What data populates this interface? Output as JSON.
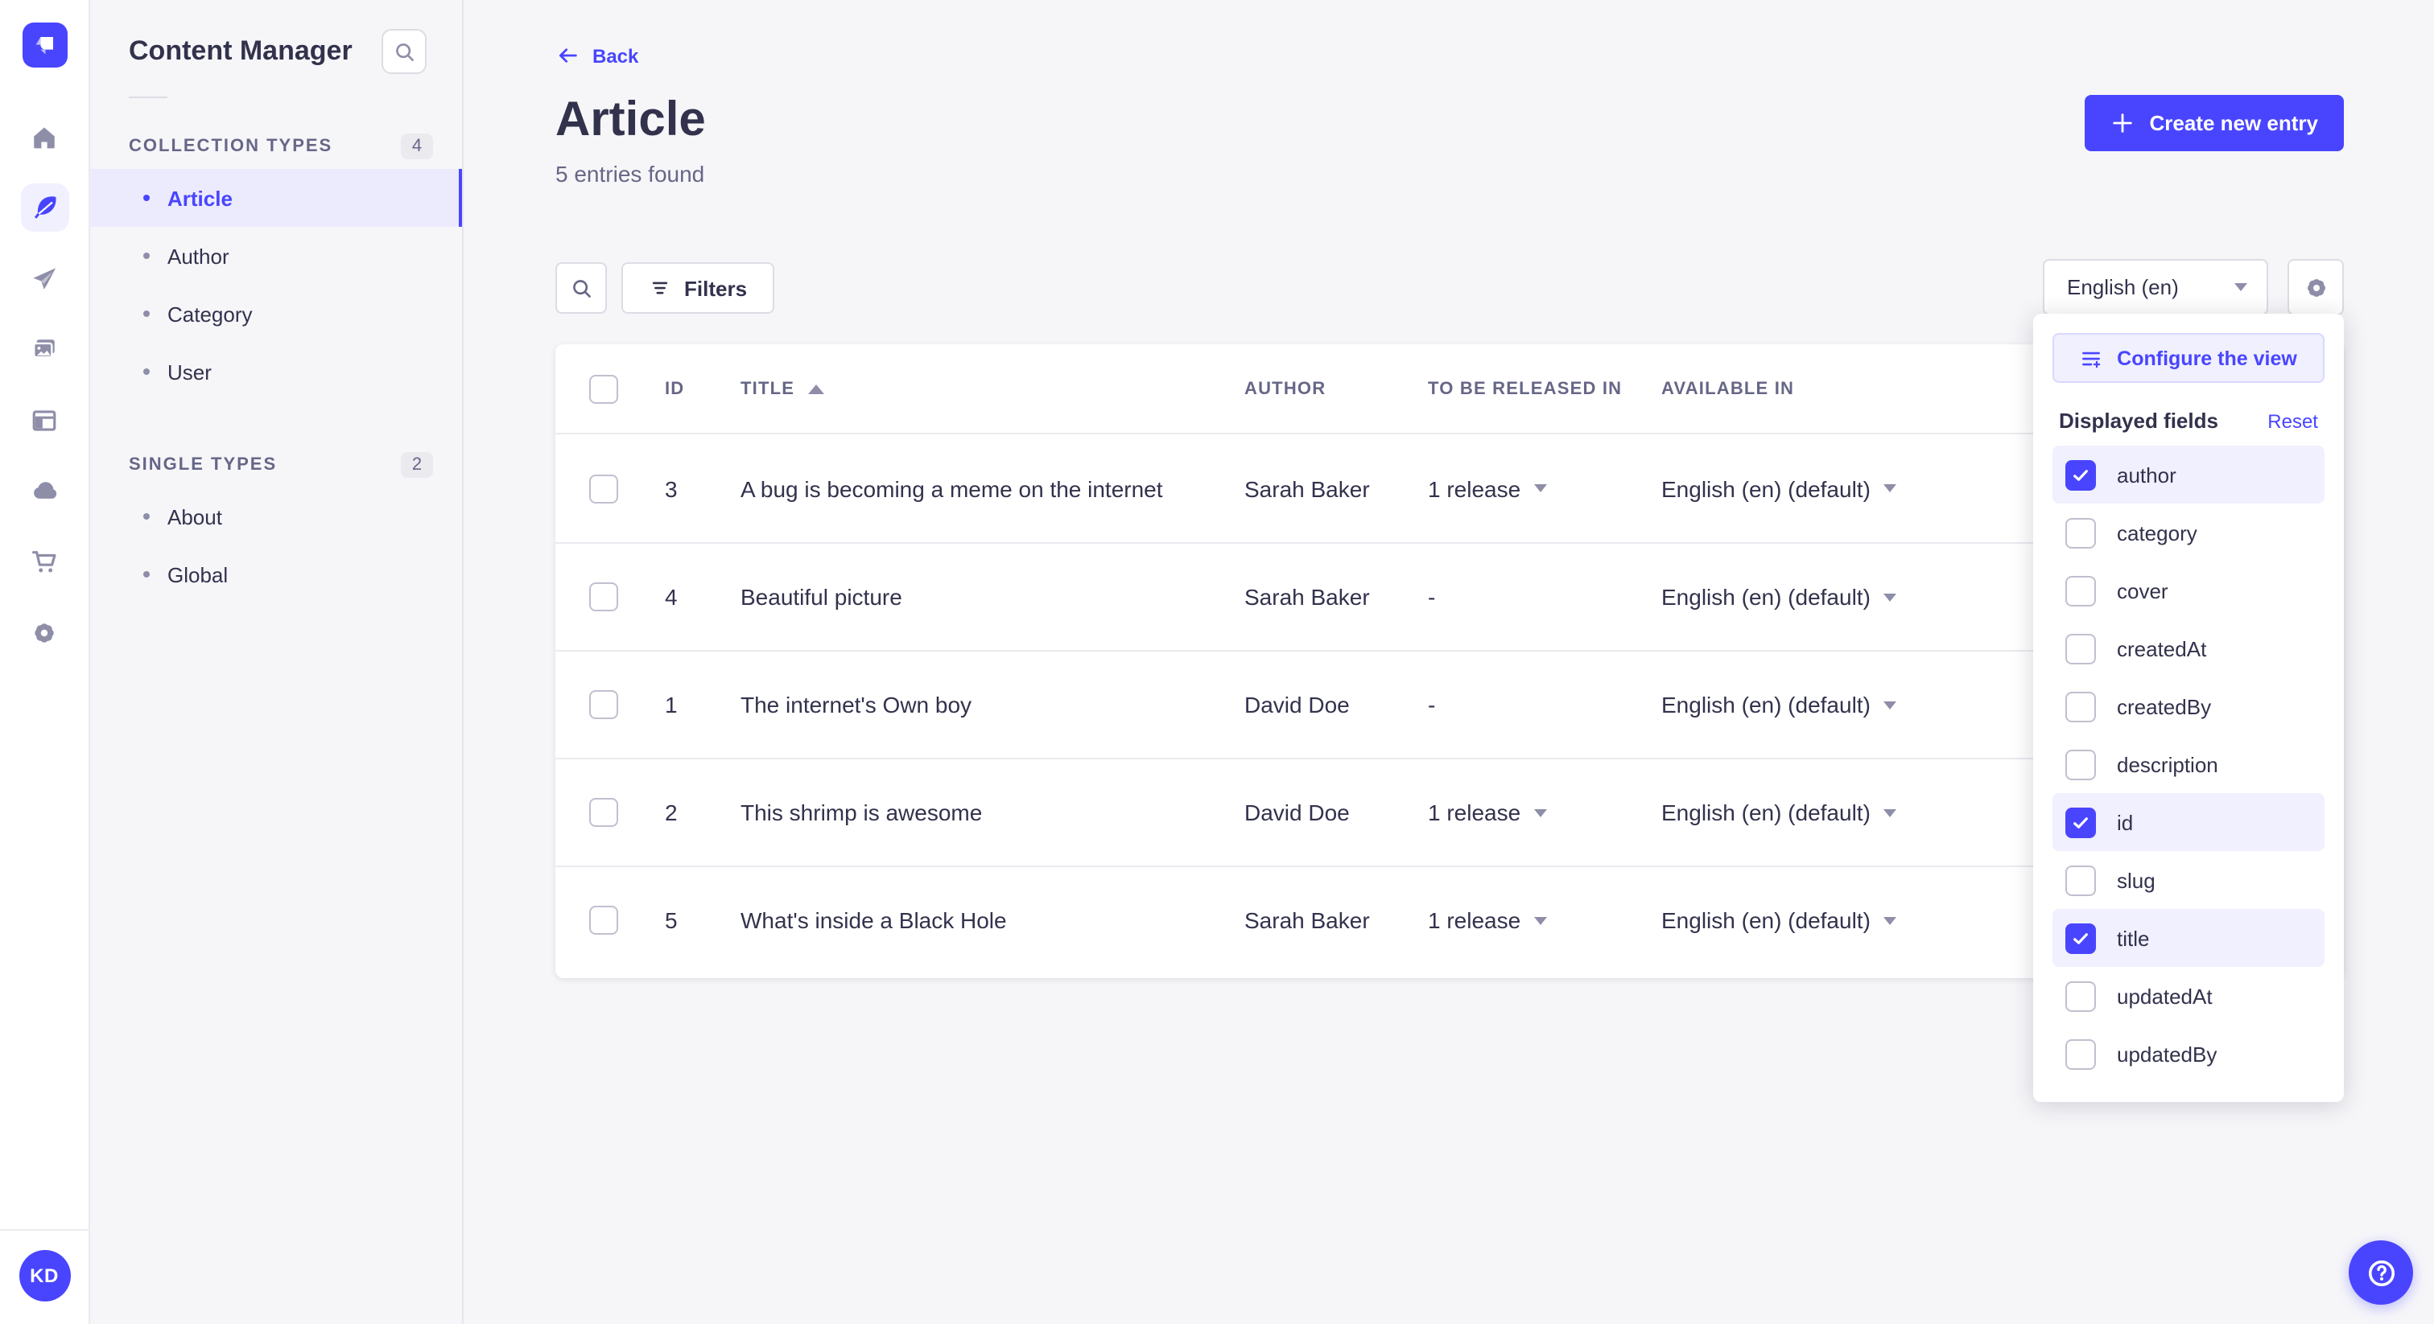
{
  "app": {
    "accent_color": "#4945ff",
    "avatar_initials": "KD"
  },
  "rail": {
    "items": [
      {
        "icon": "home-icon",
        "active": false
      },
      {
        "icon": "content-manager-feather-icon",
        "active": true
      },
      {
        "icon": "releases-paper-plane-icon",
        "active": false
      },
      {
        "icon": "media-library-images-icon",
        "active": false
      },
      {
        "icon": "content-type-builder-layout-icon",
        "active": false
      },
      {
        "icon": "deploy-cloud-icon",
        "active": false
      },
      {
        "icon": "marketplace-cart-icon",
        "active": false
      },
      {
        "icon": "settings-gear-icon",
        "active": false
      }
    ]
  },
  "sidebar": {
    "title": "Content Manager",
    "sections": [
      {
        "label": "COLLECTION TYPES",
        "count": "4",
        "items": [
          {
            "label": "Article",
            "active": true
          },
          {
            "label": "Author",
            "active": false
          },
          {
            "label": "Category",
            "active": false
          },
          {
            "label": "User",
            "active": false
          }
        ]
      },
      {
        "label": "SINGLE TYPES",
        "count": "2",
        "items": [
          {
            "label": "About",
            "active": false
          },
          {
            "label": "Global",
            "active": false
          }
        ]
      }
    ]
  },
  "header": {
    "back_label": "Back",
    "title": "Article",
    "subtitle": "5 entries found",
    "create_button": "Create new entry"
  },
  "toolbar": {
    "filters_label": "Filters",
    "locale_value": "English (en)"
  },
  "table": {
    "headers": {
      "id": "ID",
      "title": "TITLE",
      "author": "AUTHOR",
      "released": "TO BE RELEASED IN",
      "available": "AVAILABLE IN"
    },
    "sorted_column": "TITLE",
    "sort_direction": "asc",
    "rows": [
      {
        "id": "3",
        "title": "A bug is becoming a meme on the internet",
        "author": "Sarah Baker",
        "to_be_released_in": "1 release",
        "available_in": "English (en) (default)"
      },
      {
        "id": "4",
        "title": "Beautiful picture",
        "author": "Sarah Baker",
        "to_be_released_in": "-",
        "available_in": "English (en) (default)"
      },
      {
        "id": "1",
        "title": "The internet's Own boy",
        "author": "David Doe",
        "to_be_released_in": "-",
        "available_in": "English (en) (default)"
      },
      {
        "id": "2",
        "title": "This shrimp is awesome",
        "author": "David Doe",
        "to_be_released_in": "1 release",
        "available_in": "English (en) (default)"
      },
      {
        "id": "5",
        "title": "What's inside a Black Hole",
        "author": "Sarah Baker",
        "to_be_released_in": "1 release",
        "available_in": "English (en) (default)"
      }
    ]
  },
  "popover": {
    "configure_button": "Configure the view",
    "displayed_fields_label": "Displayed fields",
    "reset_label": "Reset",
    "fields": [
      {
        "label": "author",
        "checked": true
      },
      {
        "label": "category",
        "checked": false
      },
      {
        "label": "cover",
        "checked": false
      },
      {
        "label": "createdAt",
        "checked": false
      },
      {
        "label": "createdBy",
        "checked": false
      },
      {
        "label": "description",
        "checked": false
      },
      {
        "label": "id",
        "checked": true
      },
      {
        "label": "slug",
        "checked": false
      },
      {
        "label": "title",
        "checked": true
      },
      {
        "label": "updatedAt",
        "checked": false
      },
      {
        "label": "updatedBy",
        "checked": false
      }
    ]
  }
}
